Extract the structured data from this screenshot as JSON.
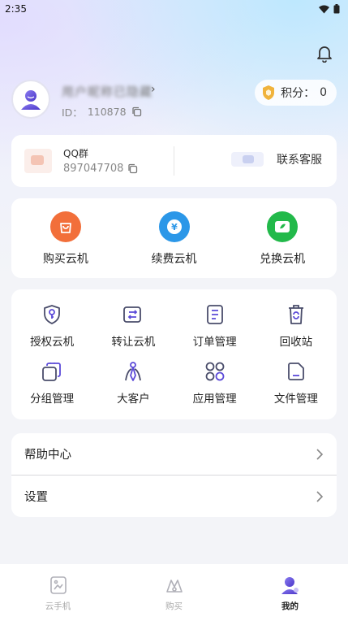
{
  "status_bar": {
    "time": "2:35"
  },
  "profile": {
    "username": "用户昵称已隐藏",
    "id_label": "ID：",
    "id_value": "110878"
  },
  "points": {
    "label": "积分：",
    "value": "0"
  },
  "contact": {
    "qq_title": "QQ群",
    "qq_number": "897047708",
    "service_label": "联系客服"
  },
  "buy_actions": [
    {
      "label": "购买云机",
      "icon": "shopping-bag-icon",
      "color": "#f26f3a"
    },
    {
      "label": "续费云机",
      "icon": "yen-coin-icon",
      "color": "#2b97e8"
    },
    {
      "label": "兑换云机",
      "icon": "exchange-ticket-icon",
      "color": "#22b94a"
    }
  ],
  "tools": [
    {
      "label": "授权云机",
      "icon": "key-shield-icon"
    },
    {
      "label": "转让云机",
      "icon": "transfer-icon"
    },
    {
      "label": "订单管理",
      "icon": "order-list-icon"
    },
    {
      "label": "回收站",
      "icon": "recycle-bin-icon"
    },
    {
      "label": "分组管理",
      "icon": "group-stack-icon"
    },
    {
      "label": "大客户",
      "icon": "vip-customer-icon"
    },
    {
      "label": "应用管理",
      "icon": "apps-grid-icon"
    },
    {
      "label": "文件管理",
      "icon": "file-icon"
    }
  ],
  "menu": {
    "help_label": "帮助中心",
    "settings_label": "设置"
  },
  "tabbar": {
    "items": [
      {
        "label": "云手机",
        "icon": "cloud-phone-icon"
      },
      {
        "label": "购买",
        "icon": "purchase-icon"
      },
      {
        "label": "我的",
        "icon": "profile-icon"
      }
    ],
    "active": "我的"
  },
  "colors": {
    "accent": "#5b4ad8",
    "icon_stroke": "#4a4d6b",
    "divider": "#e6e6e6"
  }
}
